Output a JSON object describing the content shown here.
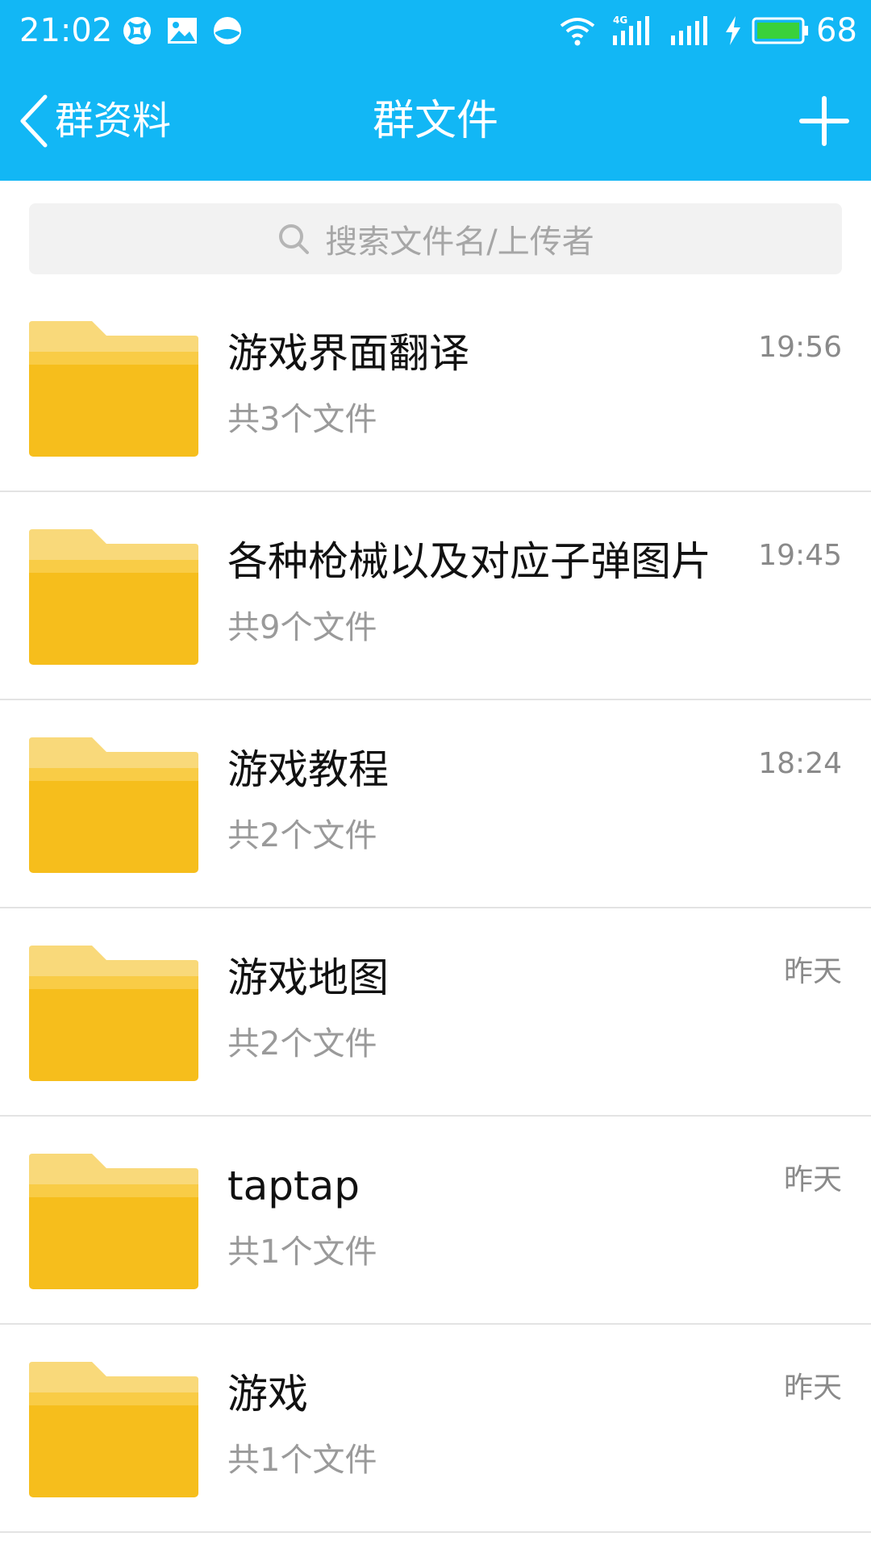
{
  "status_bar": {
    "time": "21:02",
    "network": "4G",
    "battery_level": "68",
    "icons": [
      "browser-icon",
      "image-notification-icon",
      "sync-icon",
      "wifi-icon",
      "signal-4g-icon",
      "signal-icon",
      "charging-icon",
      "battery-icon"
    ]
  },
  "header": {
    "back_label": "群资料",
    "title": "群文件",
    "add_icon": "plus-icon"
  },
  "search": {
    "placeholder": "搜索文件名/上传者"
  },
  "files": [
    {
      "name": "游戏界面翻译",
      "count": "共3个文件",
      "time": "19:56"
    },
    {
      "name": "各种枪械以及对应子弹图片",
      "count": "共9个文件",
      "time": "19:45"
    },
    {
      "name": "游戏教程",
      "count": "共2个文件",
      "time": "18:24"
    },
    {
      "name": "游戏地图",
      "count": "共2个文件",
      "time": "昨天"
    },
    {
      "name": "taptap",
      "count": "共1个文件",
      "time": "昨天"
    },
    {
      "name": "游戏",
      "count": "共1个文件",
      "time": "昨天"
    }
  ],
  "colors": {
    "header_blue": "#12b7f5",
    "folder_yellow": "#f6be1c",
    "folder_tab": "#f9d97a",
    "battery_green": "#3ad13a"
  }
}
